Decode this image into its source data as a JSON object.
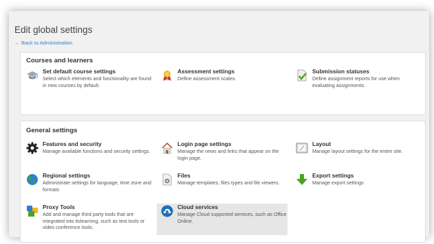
{
  "page": {
    "title": "Edit global settings",
    "back_link": "Back to Administration"
  },
  "courses_section": {
    "title": "Courses and learners",
    "items": [
      {
        "title": "Set default course settings",
        "description": "Select which elements and functionality are found in new courses by default.",
        "icon": "graduation-cap-icon"
      },
      {
        "title": "Assessment settings",
        "description": "Define assessment scales.",
        "icon": "award-ribbon-icon"
      },
      {
        "title": "Submission statuses",
        "description": "Define assignment reports for use when evaluating assignments.",
        "icon": "checked-document-icon"
      }
    ]
  },
  "general_section": {
    "title": "General settings",
    "items": [
      {
        "title": "Features and security",
        "description": "Manage available functions and security settings.",
        "icon": "gear-icon"
      },
      {
        "title": "Login page settings",
        "description": "Manage the news and links that appear on the login page.",
        "icon": "house-icon"
      },
      {
        "title": "Layout",
        "description": "Manage layout settings for the entire site.",
        "icon": "layout-window-icon"
      },
      {
        "title": "Regional settings",
        "description": "Administrate settings for language, time zone and formats",
        "icon": "globe-icon"
      },
      {
        "title": "Files",
        "description": "Manage templates, files types and file viewers.",
        "icon": "file-gear-icon"
      },
      {
        "title": "Export settings",
        "description": "Manage export settings",
        "icon": "green-down-arrow-icon"
      },
      {
        "title": "Proxy Tools",
        "description": "Add and manage third party tools that are integrated into itslearning, such as test tools or video conference tools.",
        "icon": "blocks-icon"
      },
      {
        "title": "Cloud services",
        "description": "Manage Cloud supported services, such as Office Online.",
        "icon": "cloud-download-icon"
      }
    ]
  },
  "colors": {
    "link": "#3a7fc1",
    "highlight_bg": "#e6e6e6",
    "panel_bg": "#ffffff",
    "page_bg": "#f1f1f1"
  }
}
